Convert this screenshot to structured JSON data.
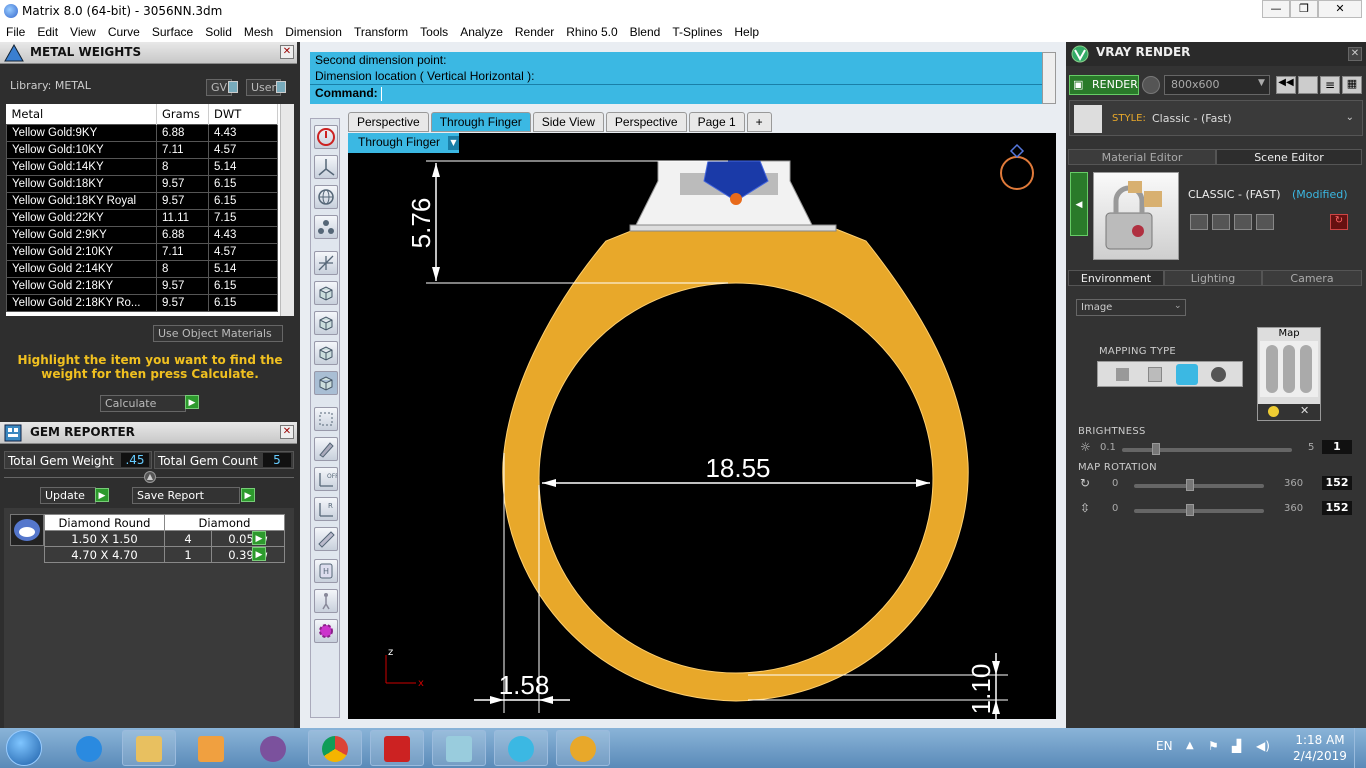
{
  "window": {
    "title": "Matrix 8.0 (64-bit) - 3056NN.3dm",
    "minimize": "—",
    "maximize": "❐",
    "close": "✕"
  },
  "menu": [
    "File",
    "Edit",
    "View",
    "Curve",
    "Surface",
    "Solid",
    "Mesh",
    "Dimension",
    "Transform",
    "Tools",
    "Analyze",
    "Render",
    "Rhino 5.0",
    "Blend",
    "T-Splines",
    "Help"
  ],
  "metal_weights": {
    "title": "METAL WEIGHTS",
    "library_label": "Library: METAL",
    "gv": "GV",
    "user": "User",
    "columns": [
      "Metal",
      "Grams",
      "DWT"
    ],
    "rows": [
      [
        "Yellow Gold:9KY",
        "6.88",
        "4.43"
      ],
      [
        "Yellow Gold:10KY",
        "7.11",
        "4.57"
      ],
      [
        "Yellow Gold:14KY",
        "8",
        "5.14"
      ],
      [
        "Yellow Gold:18KY",
        "9.57",
        "6.15"
      ],
      [
        "Yellow Gold:18KY Royal",
        "9.57",
        "6.15"
      ],
      [
        "Yellow Gold:22KY",
        "11.11",
        "7.15"
      ],
      [
        "Yellow Gold 2:9KY",
        "6.88",
        "4.43"
      ],
      [
        "Yellow Gold 2:10KY",
        "7.11",
        "4.57"
      ],
      [
        "Yellow Gold 2:14KY",
        "8",
        "5.14"
      ],
      [
        "Yellow Gold 2:18KY",
        "9.57",
        "6.15"
      ],
      [
        "Yellow Gold 2:18KY Ro...",
        "9.57",
        "6.15"
      ]
    ],
    "use_object_materials": "Use Object Materials",
    "hint": "Highlight the item you want to find the weight for then press Calculate.",
    "calculate": "Calculate"
  },
  "gem_reporter": {
    "title": "GEM REPORTER",
    "total_weight_label": "Total Gem Weight",
    "total_weight": ".45",
    "total_count_label": "Total Gem Count",
    "total_count": "5",
    "update": "Update",
    "save_report": "Save Report",
    "columns": [
      "Diamond Round",
      "",
      "Diamond"
    ],
    "rows": [
      [
        "1.50 X 1.50",
        "4",
        "0.05tw"
      ],
      [
        "4.70 X 4.70",
        "1",
        "0.39tw"
      ]
    ]
  },
  "command": {
    "line1": "Second dimension point:",
    "line2": "Dimension location ( Vertical  Horizontal ):",
    "prompt": "Command:"
  },
  "view_tabs": [
    "Perspective",
    "Through Finger",
    "Side View",
    "Perspective",
    "Page 1",
    "+"
  ],
  "viewport": {
    "dropdown": "Through Finger",
    "dims": {
      "top": "5.76",
      "width": "18.55",
      "left": "1.58",
      "right": "1.10"
    },
    "axis_z": "z",
    "axis_x": "x",
    "colors": {
      "metal": "#e8a82a",
      "gem": "#1a3aa8",
      "setting": "#f2f2f2"
    }
  },
  "vray": {
    "title": "VRAY RENDER",
    "render": "RENDER",
    "resolution": "800x600",
    "style_label": "STYLE:",
    "style_value": "Classic - (Fast)",
    "tabs": [
      "Material Editor",
      "Scene Editor"
    ],
    "preset_name": "CLASSIC - (FAST)",
    "preset_modified": "(Modified)",
    "env_tabs": [
      "Environment",
      "Lighting",
      "Camera"
    ],
    "env_type": "Image",
    "mapping_type": "MAPPING TYPE",
    "map_label": "Map",
    "brightness_label": "BRIGHTNESS",
    "brightness": {
      "min": "0.1",
      "max": "5",
      "value": "1"
    },
    "map_rotation_label": "MAP ROTATION",
    "rotation1": {
      "min": "0",
      "max": "360",
      "value": "152"
    },
    "rotation2": {
      "min": "0",
      "max": "360",
      "value": "152"
    }
  },
  "taskbar": {
    "lang": "EN",
    "time": "1:18 AM",
    "date": "2/4/2019"
  }
}
